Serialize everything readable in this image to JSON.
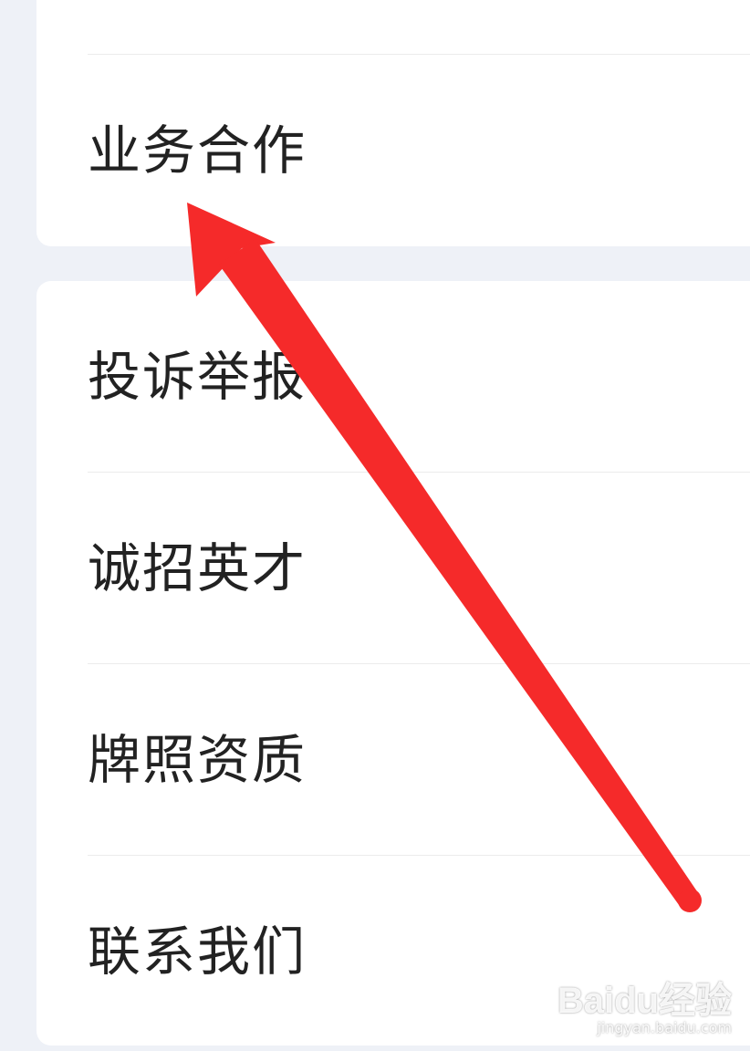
{
  "menu": {
    "top_card": {
      "items": [
        {
          "label": "业务合作"
        }
      ]
    },
    "bottom_card": {
      "items": [
        {
          "label": "投诉举报"
        },
        {
          "label": "诚招英才"
        },
        {
          "label": "牌照资质"
        },
        {
          "label": "联系我们"
        }
      ]
    }
  },
  "annotation": {
    "arrow_color": "#f52a2a",
    "arrow_target": "业务合作"
  },
  "watermark": {
    "brand": "Baidu经验",
    "url": "jingyan.baidu.com"
  },
  "colors": {
    "background": "#eef1f7",
    "card": "#ffffff",
    "text": "#222222",
    "divider": "#ececec"
  }
}
